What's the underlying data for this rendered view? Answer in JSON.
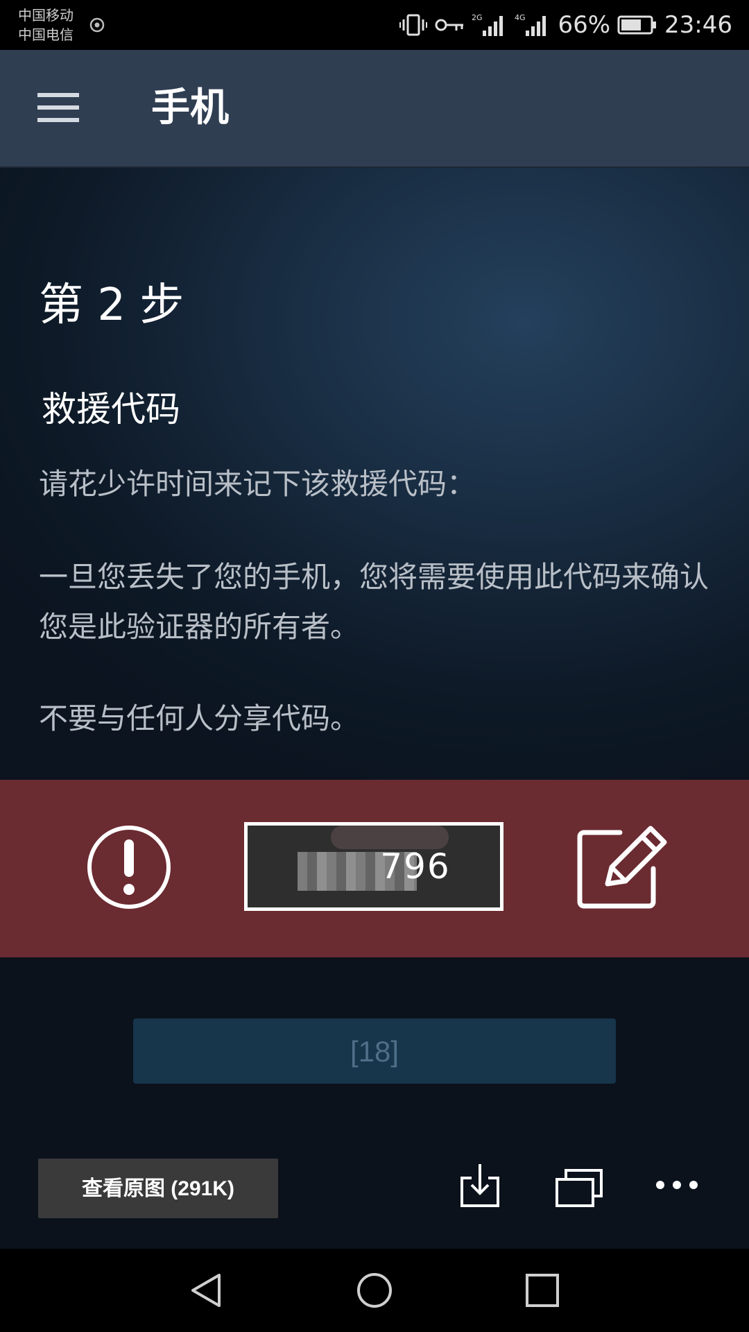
{
  "status_bar": {
    "carrier_1": "中国移动",
    "carrier_2": "中国电信",
    "signal_2g": "2G",
    "signal_4g": "4G",
    "battery": "66%",
    "time": "23:46"
  },
  "header": {
    "title": "手机"
  },
  "content": {
    "step": "第 2 步",
    "section_title": "救援代码",
    "paragraph_1": "请花少许时间来记下该救援代码：",
    "paragraph_2": "一旦您丢失了您的手机，您将需要使用此代码来确认您是此验证器的所有者。",
    "paragraph_3": "不要与任何人分享代码。"
  },
  "code_band": {
    "visible_code": "796",
    "band_color": "#6a2b31"
  },
  "next_button": {
    "label": "[18]"
  },
  "viewer_bar": {
    "view_original_label": "查看原图 (291K)"
  },
  "icons": {
    "menu": "menu-icon",
    "warning": "warning-icon",
    "edit": "edit-icon",
    "download": "download-icon",
    "multiwindow": "multiwindow-icon",
    "more": "more-icon",
    "nav_back": "back-icon",
    "nav_home": "home-icon",
    "nav_recent": "recent-apps-icon"
  },
  "colors": {
    "header_bg": "#303e52",
    "accent_button": "#17354b",
    "button_text": "#4f6f88"
  }
}
